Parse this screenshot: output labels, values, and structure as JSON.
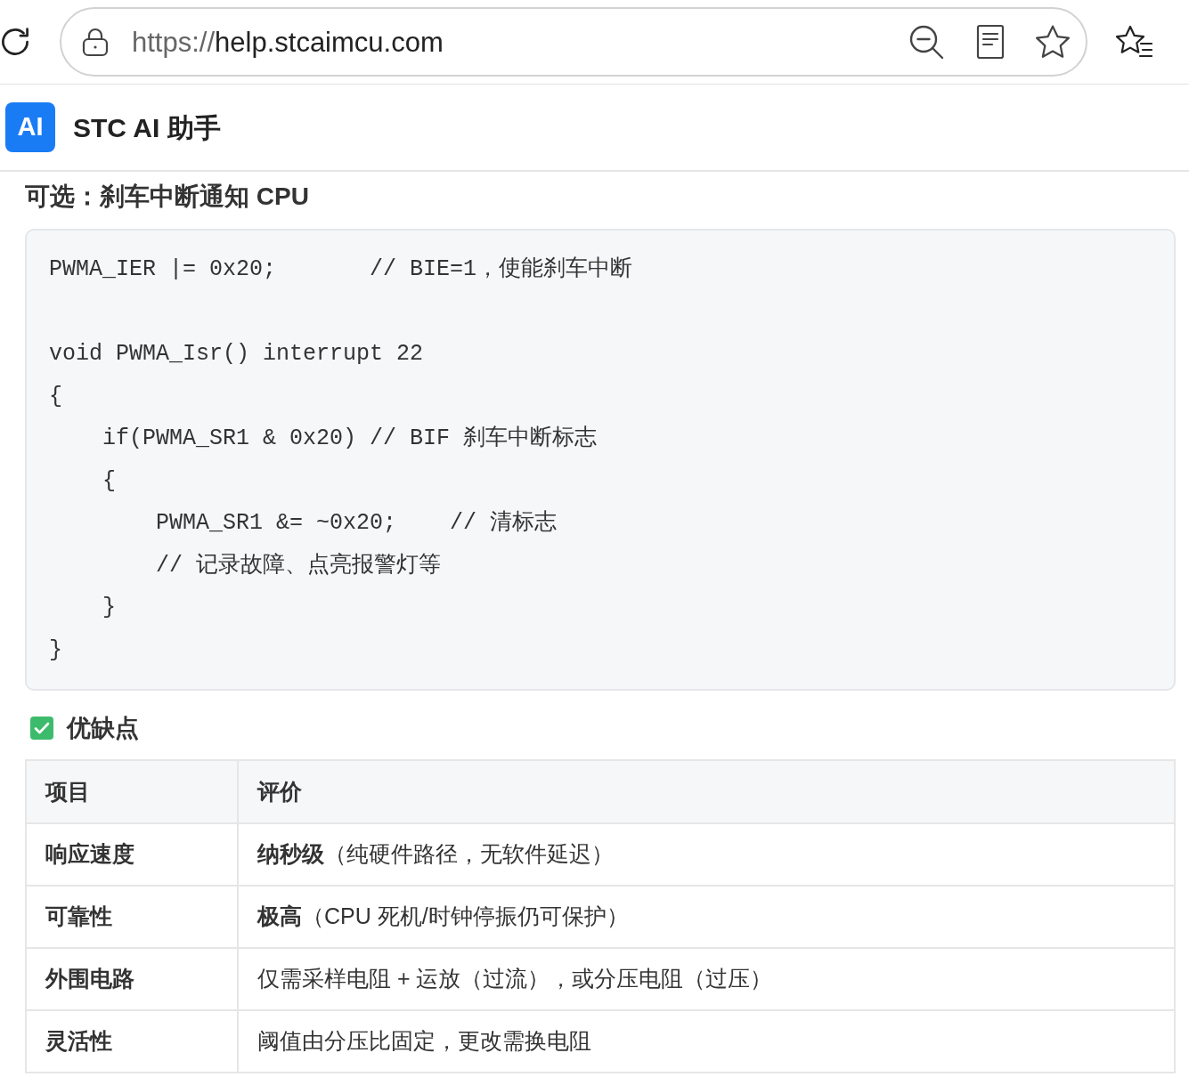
{
  "browser": {
    "url": {
      "scheme": "https://",
      "host": "help.stcaimcu.com"
    }
  },
  "app_header": {
    "logo_text": "AI",
    "title": "STC AI 助手"
  },
  "section_heading": "可选：刹车中断通知 CPU",
  "code_block": {
    "code": "PWMA_IER |= 0x20;       // BIE=1，使能刹车中断\n\nvoid PWMA_Isr() interrupt 22\n{\n    if(PWMA_SR1 & 0x20) // BIF 刹车中断标志\n    {\n        PWMA_SR1 &= ~0x20;    // 清标志\n        // 记录故障、点亮报警灯等\n    }\n}"
  },
  "pros_cons": {
    "heading": "优缺点",
    "table": {
      "columns": [
        "项目",
        "评价"
      ],
      "rows": [
        [
          "响应速度",
          "**纳秒级**（纯硬件路径，无软件延迟）"
        ],
        [
          "可靠性",
          "**极高**（CPU 死机/时钟停振仍可保护）"
        ],
        [
          "外围电路",
          "仅需采样电阻 + 运放（过流），或分压电阻（过压）"
        ],
        [
          "灵活性",
          "阈值由分压比固定，更改需换电阻"
        ]
      ]
    }
  }
}
